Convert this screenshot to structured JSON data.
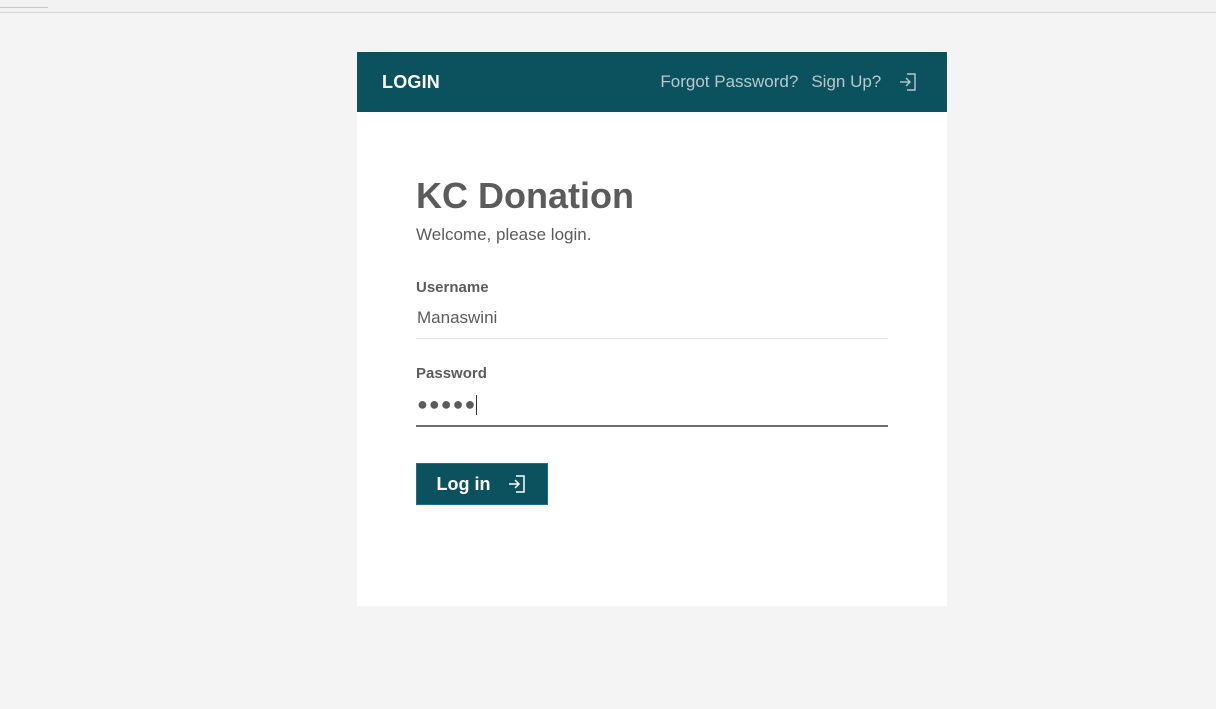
{
  "header": {
    "title": "LOGIN",
    "forgot_password": "Forgot Password?",
    "sign_up": "Sign Up?",
    "sign_up_icon": "login-arrow-icon"
  },
  "main": {
    "app_title": "KC Donation",
    "subtitle": "Welcome, please login."
  },
  "form": {
    "username_label": "Username",
    "username_value": "Manaswini",
    "password_label": "Password",
    "password_value": "●●●●●",
    "submit_label": "Log in",
    "submit_icon": "login-arrow-icon"
  },
  "colors": {
    "brand": "#0b525e",
    "background": "#f4f4f4",
    "text": "#5b5b5b",
    "header_link": "#b9c8cb"
  }
}
